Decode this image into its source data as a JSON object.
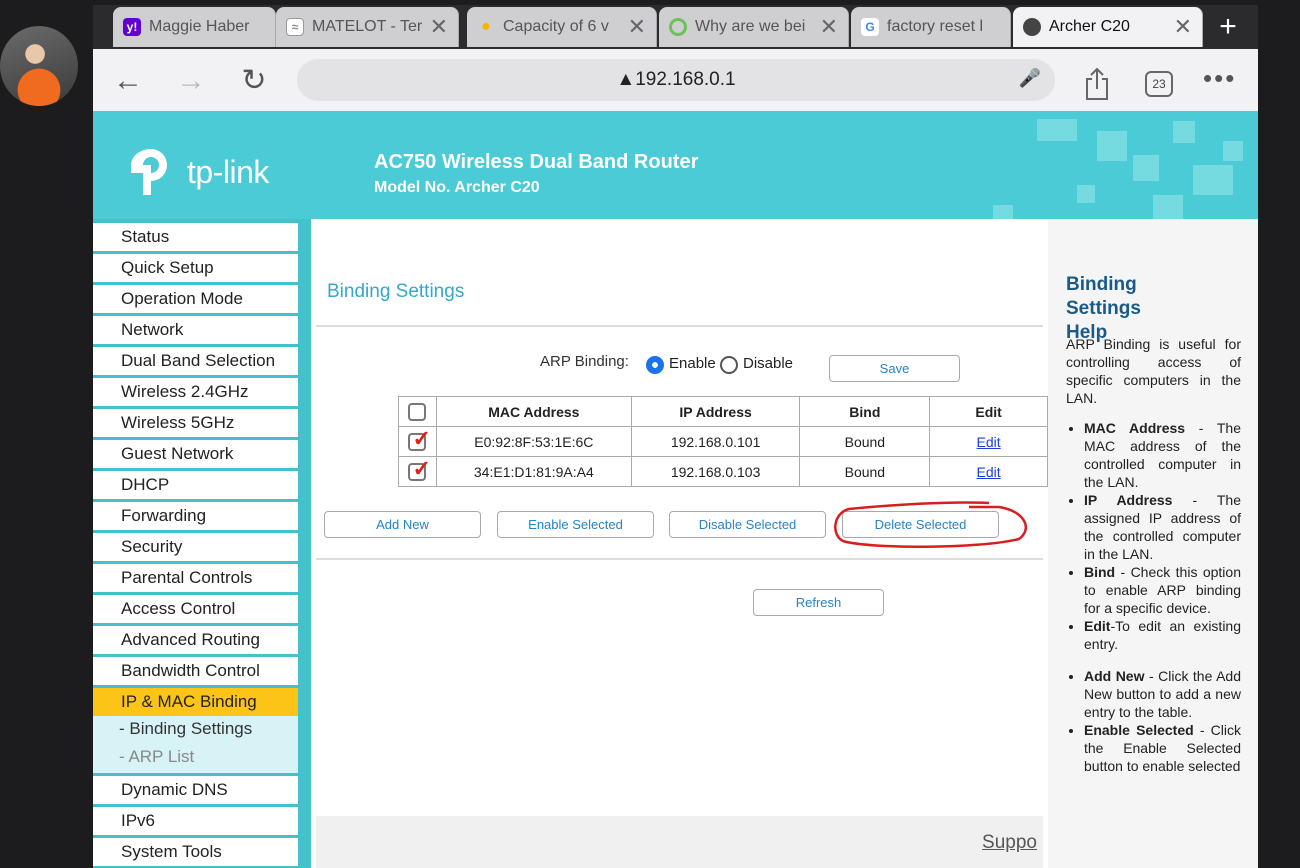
{
  "browser": {
    "tabs": [
      {
        "title": "Maggie Haber",
        "favicon": "yahoo-icon",
        "color": "#6001d2"
      },
      {
        "title": "MATELOT - Ter",
        "favicon": "matelot-icon",
        "color": "#888888"
      },
      {
        "title": "Capacity of 6 v",
        "favicon": "lightbulb-icon",
        "color": "#f5b400"
      },
      {
        "title": "Why are we bei",
        "favicon": "ring-icon",
        "color": "#6ac259"
      },
      {
        "title": "factory reset l",
        "favicon": "google-icon",
        "color": "#4285f4"
      },
      {
        "title": "Archer C20",
        "favicon": "globe-icon",
        "color": "#444444"
      }
    ],
    "url": "192.168.0.1",
    "tab_count": "23"
  },
  "header": {
    "brand": "tp-link",
    "product": "AC750 Wireless Dual Band Router",
    "model": "Model No. Archer C20"
  },
  "menu": {
    "items": [
      "Status",
      "Quick Setup",
      "Operation Mode",
      "Network",
      "Dual Band Selection",
      "Wireless 2.4GHz",
      "Wireless 5GHz",
      "Guest Network",
      "DHCP",
      "Forwarding",
      "Security",
      "Parental Controls",
      "Access Control",
      "Advanced Routing",
      "Bandwidth Control",
      "IP & MAC Binding"
    ],
    "sub_items": [
      "- Binding Settings",
      "- ARP List"
    ],
    "items_after": [
      "Dynamic DNS",
      "IPv6",
      "System Tools"
    ]
  },
  "content": {
    "title": "Binding Settings",
    "arp_label": "ARP Binding:",
    "enable_label": "Enable",
    "disable_label": "Disable",
    "arp_state": "Enable",
    "save_label": "Save",
    "table": {
      "headers": [
        "MAC Address",
        "IP Address",
        "Bind",
        "Edit"
      ],
      "rows": [
        {
          "mac": "E0:92:8F:53:1E:6C",
          "ip": "192.168.0.101",
          "bind": "Bound",
          "edit": "Edit",
          "checked": true
        },
        {
          "mac": "34:E1:D1:81:9A:A4",
          "ip": "192.168.0.103",
          "bind": "Bound",
          "edit": "Edit",
          "checked": true
        }
      ]
    },
    "buttons": {
      "add_new": "Add New",
      "enable_selected": "Enable Selected",
      "disable_selected": "Disable Selected",
      "delete_selected": "Delete Selected",
      "refresh": "Refresh"
    },
    "support": "Suppo",
    "annotation_color": "#d81e1e"
  },
  "help": {
    "title_line1_a": "Binding",
    "title_line1_b": "Settings",
    "title_line2": "Help",
    "intro": "ARP Binding is useful for controlling access of specific computers in the LAN.",
    "items": [
      {
        "term": "MAC Address",
        "text": " - The MAC address of the controlled computer in the LAN."
      },
      {
        "term": "IP Address",
        "text": " - The assigned IP address of the controlled computer in the LAN."
      },
      {
        "term": "Bind",
        "text": " - Check this option to enable ARP binding for a specific device."
      },
      {
        "term": "Edit",
        "text": "-To edit an existing entry."
      },
      {
        "term": "Add New",
        "text": " - Click the Add New button to add a new entry to the table."
      },
      {
        "term": "Enable Selected",
        "text": " - Click the Enable Selected button to enable selected"
      }
    ]
  }
}
